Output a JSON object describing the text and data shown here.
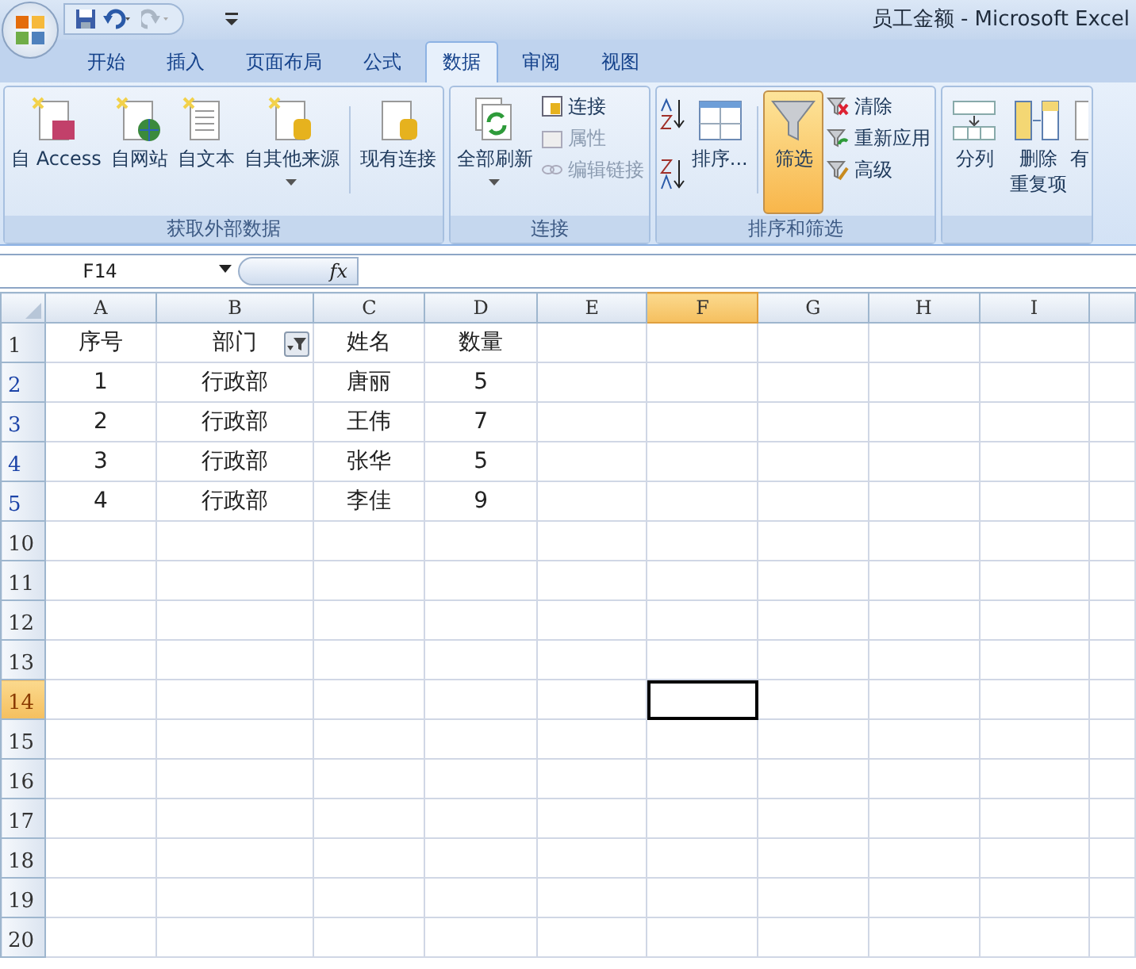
{
  "window": {
    "title": "员工金额 - Microsoft Excel"
  },
  "tabs": [
    {
      "label": "开始",
      "selected": false
    },
    {
      "label": "插入",
      "selected": false
    },
    {
      "label": "页面布局",
      "selected": false
    },
    {
      "label": "公式",
      "selected": false
    },
    {
      "label": "数据",
      "selected": true
    },
    {
      "label": "审阅",
      "selected": false
    },
    {
      "label": "视图",
      "selected": false
    }
  ],
  "ribbon_groups": [
    {
      "label": "获取外部数据",
      "buttons": [
        {
          "kind": "large",
          "label": "自 Access",
          "dropdown": false,
          "disabled": false,
          "on": false
        },
        {
          "kind": "large",
          "label": "自网站",
          "dropdown": false,
          "disabled": false,
          "on": false
        },
        {
          "kind": "large",
          "label": "自文本",
          "dropdown": false,
          "disabled": false,
          "on": false
        },
        {
          "kind": "large",
          "label": "自其他来源",
          "dropdown": true,
          "disabled": false,
          "on": false
        },
        {
          "kind": "separator"
        },
        {
          "kind": "large",
          "label": "现有连接",
          "dropdown": false,
          "disabled": false,
          "on": false
        }
      ]
    },
    {
      "label": "连接",
      "buttons": [
        {
          "kind": "large",
          "label": "全部刷新",
          "dropdown": true,
          "disabled": false,
          "on": false
        },
        {
          "kind": "stack",
          "items": [
            {
              "label": "连接",
              "disabled": false
            },
            {
              "label": "属性",
              "disabled": true
            },
            {
              "label": "编辑链接",
              "disabled": true
            }
          ]
        }
      ]
    },
    {
      "label": "排序和筛选",
      "buttons": [
        {
          "kind": "sorticons"
        },
        {
          "kind": "large",
          "label": "排序...",
          "dropdown": false,
          "disabled": false,
          "on": false
        },
        {
          "kind": "separator"
        },
        {
          "kind": "large",
          "label": "筛选",
          "dropdown": false,
          "disabled": false,
          "on": true
        },
        {
          "kind": "stack",
          "items": [
            {
              "label": "清除",
              "disabled": false
            },
            {
              "label": "重新应用",
              "disabled": false
            },
            {
              "label": "高级",
              "disabled": false
            }
          ]
        }
      ]
    },
    {
      "buttons": [
        {
          "kind": "large",
          "label": "分列",
          "dropdown": false,
          "disabled": false,
          "on": false
        },
        {
          "kind": "large",
          "label": "删除",
          "second_line": "重复项",
          "dropdown": false,
          "disabled": false,
          "on": false
        },
        {
          "kind": "large",
          "label": "有",
          "dropdown": false,
          "disabled": false,
          "on": false
        }
      ]
    }
  ],
  "formula_bar": {
    "name_box": "F14",
    "fx": "fx"
  },
  "columns": [
    {
      "label": "A",
      "selected": false,
      "filtered": false
    },
    {
      "label": "B",
      "selected": false,
      "filtered": true
    },
    {
      "label": "C",
      "selected": false,
      "filtered": false
    },
    {
      "label": "D",
      "selected": false,
      "filtered": false
    },
    {
      "label": "E",
      "selected": false,
      "filtered": false
    },
    {
      "label": "F",
      "selected": true,
      "filtered": false
    },
    {
      "label": "G",
      "selected": false,
      "filtered": false
    },
    {
      "label": "H",
      "selected": false,
      "filtered": false
    },
    {
      "label": "I",
      "selected": false,
      "filtered": false
    }
  ],
  "rows": [
    {
      "number": "1",
      "filtered": false,
      "selected": false,
      "cells": [
        "序号",
        "部门",
        "姓名",
        "数量"
      ]
    },
    {
      "number": "2",
      "filtered": true,
      "selected": false,
      "cells": [
        "1",
        "行政部",
        "唐丽",
        "5"
      ]
    },
    {
      "number": "3",
      "filtered": true,
      "selected": false,
      "cells": [
        "2",
        "行政部",
        "王伟",
        "7"
      ]
    },
    {
      "number": "4",
      "filtered": true,
      "selected": false,
      "cells": [
        "3",
        "行政部",
        "张华",
        "5"
      ]
    },
    {
      "number": "5",
      "filtered": true,
      "selected": false,
      "cells": [
        "4",
        "行政部",
        "李佳",
        "9"
      ]
    },
    {
      "number": "10",
      "filtered": false,
      "selected": false,
      "cells": []
    },
    {
      "number": "11",
      "filtered": false,
      "selected": false,
      "cells": []
    },
    {
      "number": "12",
      "filtered": false,
      "selected": false,
      "cells": []
    },
    {
      "number": "13",
      "filtered": false,
      "selected": false,
      "cells": []
    },
    {
      "number": "14",
      "filtered": false,
      "selected": true,
      "cells": []
    },
    {
      "number": "15",
      "filtered": false,
      "selected": false,
      "cells": []
    },
    {
      "number": "16",
      "filtered": false,
      "selected": false,
      "cells": []
    },
    {
      "number": "17",
      "filtered": false,
      "selected": false,
      "cells": []
    },
    {
      "number": "18",
      "filtered": false,
      "selected": false,
      "cells": []
    },
    {
      "number": "19",
      "filtered": false,
      "selected": false,
      "cells": []
    },
    {
      "number": "20",
      "filtered": false,
      "selected": false,
      "cells": []
    }
  ]
}
